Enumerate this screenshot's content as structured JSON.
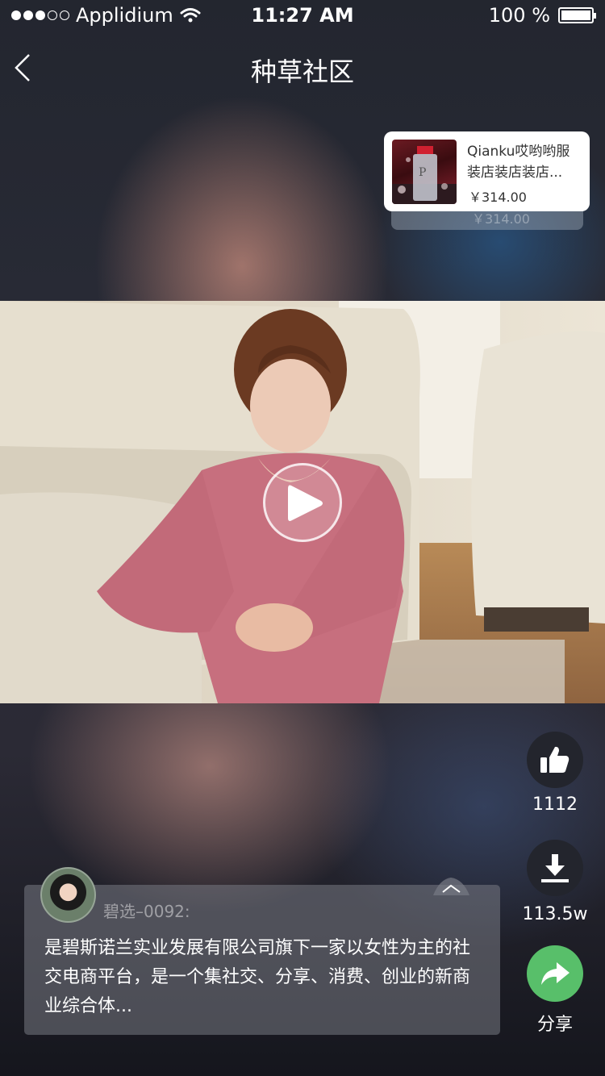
{
  "status_bar": {
    "carrier": "Applidium",
    "time": "11:27 AM",
    "battery": "100 %"
  },
  "nav": {
    "title": "种草社区"
  },
  "product": {
    "name": "Qianku哎哟哟服装店装店装店...",
    "price": "￥314.00",
    "shadow_price": "￥314.00"
  },
  "actions": {
    "like_count": "1112",
    "download_count": "113.5w",
    "share_label": "分享"
  },
  "comment": {
    "username": "碧选–0092:",
    "text": "是碧斯诺兰实业发展有限公司旗下一家以女性为主的社交电商平台，是一个集社交、分享、消费、创业的新商业综合体..."
  },
  "colors": {
    "share_green": "#58bf6a",
    "action_bg": "#23252d"
  }
}
